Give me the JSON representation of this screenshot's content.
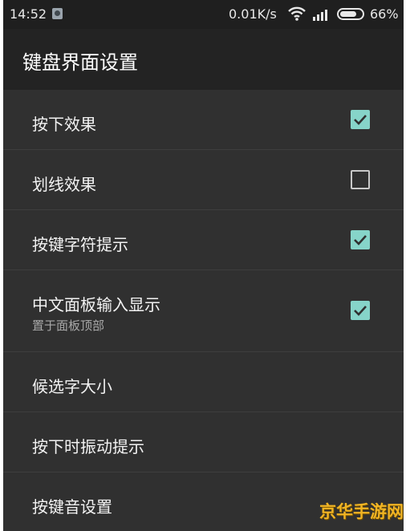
{
  "status_bar": {
    "time": "14:52",
    "net_speed": "0.01K/s",
    "battery_pct": "66%",
    "icons": [
      "app-icon",
      "wifi-icon",
      "signal-icon",
      "battery-icon"
    ]
  },
  "header": {
    "title": "键盘界面设置"
  },
  "settings": {
    "items": [
      {
        "label": "按下效果",
        "checked": true
      },
      {
        "label": "划线效果",
        "checked": false
      },
      {
        "label": "按键字符提示",
        "checked": true
      },
      {
        "label": "中文面板输入显示",
        "sublabel": "置于面板顶部",
        "checked": true
      },
      {
        "label": "候选字大小"
      },
      {
        "label": "按下时振动提示"
      },
      {
        "label": "按键音设置"
      }
    ]
  },
  "colors": {
    "accent": "#86d4c9",
    "background": "#303030",
    "title_bar": "#232323",
    "status_bar": "#1f1f1f"
  },
  "watermark": {
    "text": "京华手游网"
  }
}
